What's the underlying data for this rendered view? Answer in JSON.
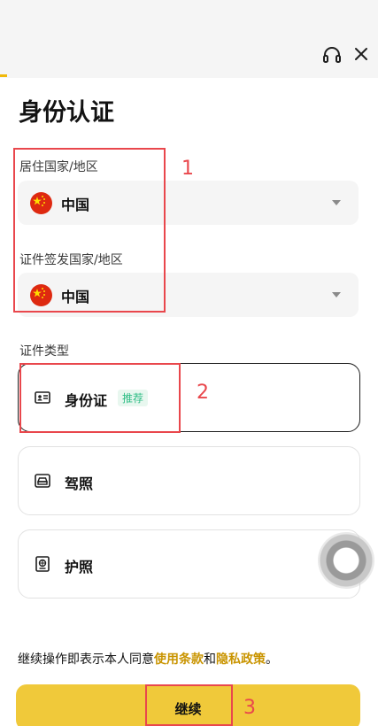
{
  "header": {
    "support_icon": "headset-icon",
    "close_icon": "close-icon",
    "accent_color": "#f0b90b"
  },
  "page": {
    "title": "身份认证"
  },
  "residence": {
    "label": "居住国家/地区",
    "value": "中国",
    "flag": "china-flag-icon"
  },
  "issuing": {
    "label": "证件签发国家/地区",
    "value": "中国",
    "flag": "china-flag-icon"
  },
  "doc_types": {
    "label": "证件类型",
    "items": [
      {
        "label": "身份证",
        "badge": "推荐",
        "icon": "id-card-icon",
        "selected": true
      },
      {
        "label": "驾照",
        "icon": "driver-license-icon",
        "selected": false
      },
      {
        "label": "护照",
        "icon": "passport-icon",
        "selected": false
      }
    ]
  },
  "consent": {
    "prefix": "继续操作即表示本人同意",
    "terms_link": "使用条款",
    "conjunction": "和",
    "privacy_link": "隐私政策",
    "suffix": "。"
  },
  "continue_button": {
    "label": "继续",
    "color": "#f0c93a"
  },
  "annotations": [
    {
      "number": "1"
    },
    {
      "number": "2"
    },
    {
      "number": "3"
    }
  ],
  "colors": {
    "link": "#c99400",
    "badge_text": "#2ebd85",
    "annotation": "#e9474c"
  }
}
